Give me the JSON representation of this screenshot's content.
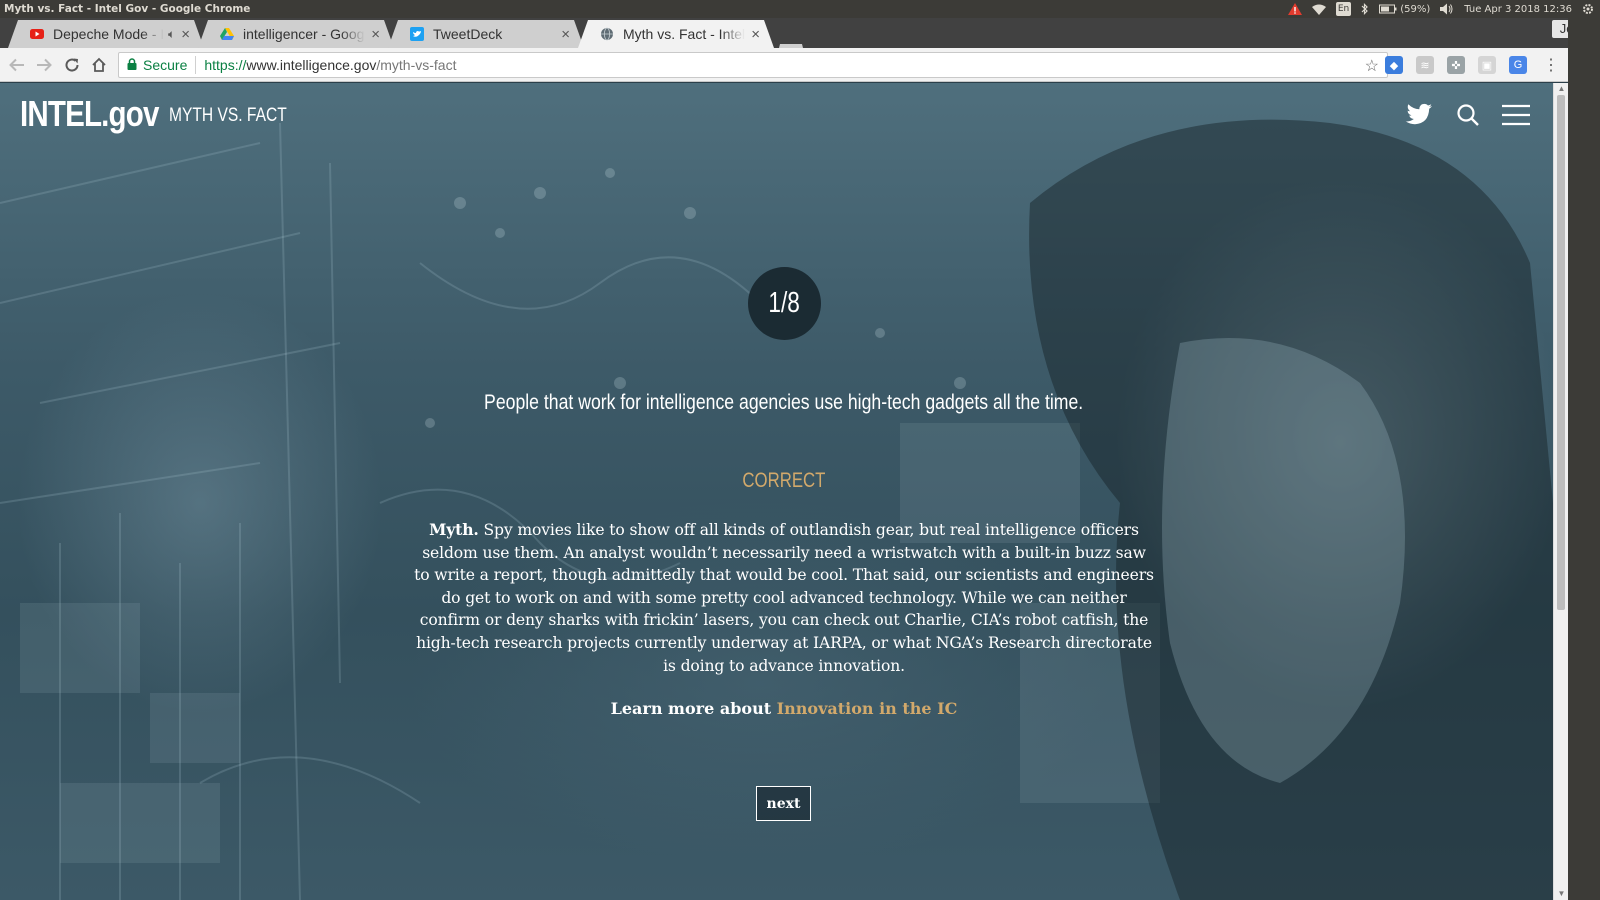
{
  "os": {
    "window_title": "Myth vs. Fact - Intel Gov - Google Chrome",
    "language": "En",
    "battery": "(59%)",
    "datetime": "Tue Apr 3 2018 12:36"
  },
  "browser": {
    "tabs": [
      {
        "title": "Depeche Mode - I",
        "icon": "youtube-icon",
        "active": false
      },
      {
        "title": "intelligencer - Goog",
        "icon": "google-drive-icon",
        "active": false
      },
      {
        "title": "TweetDeck",
        "icon": "tweetdeck-icon",
        "active": false
      },
      {
        "title": "Myth vs. Fact - Intel",
        "icon": "globe-icon",
        "active": true
      }
    ],
    "profile_name": "John",
    "secure_label": "Secure",
    "url_protocol": "https://",
    "url_host": "www.intelligence.gov",
    "url_path": "/myth-vs-fact"
  },
  "site": {
    "logo": "INTEL.gov",
    "section": "MYTH VS. FACT"
  },
  "slide": {
    "counter": "1/8",
    "statement": "People that work for intelligence agencies use high-tech gadgets all the time.",
    "verdict": "CORRECT",
    "explanation_lead": "Myth.",
    "explanation_body": " Spy movies like to show off all kinds of outlandish gear, but real intelligence officers seldom use them. An analyst wouldn’t necessarily need a wristwatch with a built-in buzz saw to write a report, though admittedly that would be cool. That said, our scientists and engineers do get to work on and with some pretty cool advanced technology. While we can neither confirm or deny sharks with frickin’ lasers, you can check out Charlie, CIA’s robot catfish, the high-tech research projects currently underway at IARPA, or what NGA’s Research directorate is doing to advance innovation.",
    "learn_prefix": "Learn more about ",
    "learn_link": "Innovation in the IC",
    "next_label": "next"
  },
  "colors": {
    "accent": "#d2a96b",
    "counter_bg": "#1b2b33",
    "secure_green": "#0b8043"
  }
}
